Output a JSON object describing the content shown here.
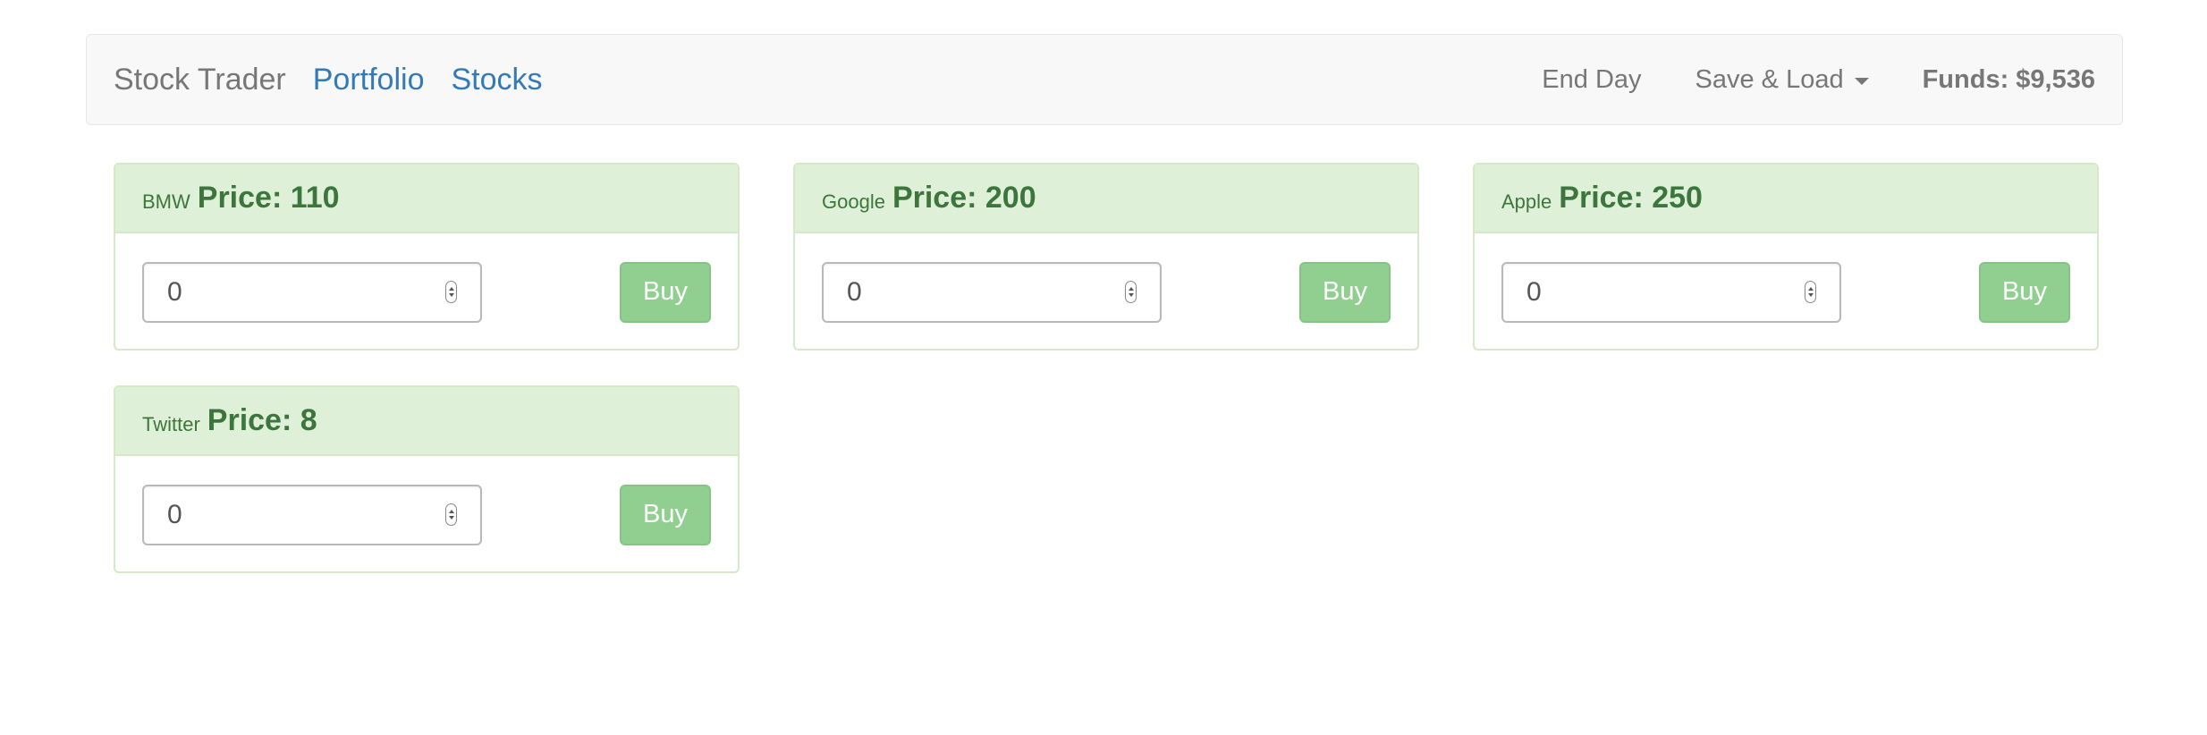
{
  "navbar": {
    "brand": "Stock Trader",
    "links": [
      "Portfolio",
      "Stocks"
    ],
    "end_day": "End Day",
    "save_load": "Save & Load",
    "funds": "Funds: $9,536"
  },
  "stocks": [
    {
      "name": "BMW",
      "price_label": "Price: 110",
      "quantity": "0",
      "buy_label": "Buy"
    },
    {
      "name": "Google",
      "price_label": "Price: 200",
      "quantity": "0",
      "buy_label": "Buy"
    },
    {
      "name": "Apple",
      "price_label": "Price: 250",
      "quantity": "0",
      "buy_label": "Buy"
    },
    {
      "name": "Twitter",
      "price_label": "Price: 8",
      "quantity": "0",
      "buy_label": "Buy"
    }
  ],
  "colors": {
    "panel_header_bg": "#dff0d8",
    "panel_text": "#3c763d",
    "buy_button": "#91cf91",
    "link": "#337ab7"
  }
}
